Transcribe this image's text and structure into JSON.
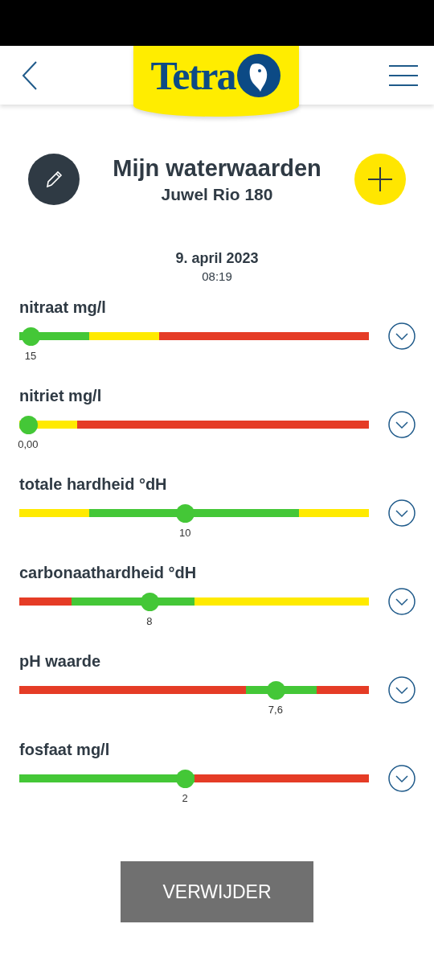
{
  "header": {
    "logo_text": "Tetra"
  },
  "title": "Mijn waterwaarden",
  "subtitle": "Juwel Rio 180",
  "date": "9. april 2023",
  "time": "08:19",
  "parameters": [
    {
      "name": "nitraat mg/l",
      "level": 0.032,
      "reading": "15",
      "segments": [
        {
          "color": "#44c737",
          "level": 0.2
        },
        {
          "color": "#ffea00",
          "level": 0.4
        },
        {
          "color": "#e53c26"
        }
      ]
    },
    {
      "name": "nitriet mg/l",
      "level": 0.025,
      "reading": "0,00",
      "segments": [
        {
          "color": "#ffea00",
          "level": 0.165
        },
        {
          "color": "#e53c26"
        }
      ]
    },
    {
      "name": "totale hardheid °dH",
      "level": 0.474,
      "reading": "10",
      "segments": [
        {
          "color": "#ffea00",
          "level": 0.2
        },
        {
          "color": "#44c737",
          "level": 0.8
        },
        {
          "color": "#ffea00"
        }
      ]
    },
    {
      "name": "carbonaathardheid °dH",
      "level": 0.372,
      "reading": "8",
      "segments": [
        {
          "color": "#e53c26",
          "level": 0.15
        },
        {
          "color": "#44c737",
          "level": 0.5
        },
        {
          "color": "#ffea00"
        }
      ]
    },
    {
      "name": "pH waarde",
      "level": 0.733,
      "reading": "7,6",
      "segments": [
        {
          "color": "#e53c26",
          "level": 0.648
        },
        {
          "color": "#44c737",
          "level": 0.85
        },
        {
          "color": "#e53c26"
        }
      ]
    },
    {
      "name": "fosfaat mg/l",
      "level": 0.474,
      "reading": "2",
      "segments": [
        {
          "color": "#44c737",
          "level": 0.5
        },
        {
          "color": "#e53c26"
        }
      ]
    }
  ],
  "delete_button": "VERWIJDER"
}
